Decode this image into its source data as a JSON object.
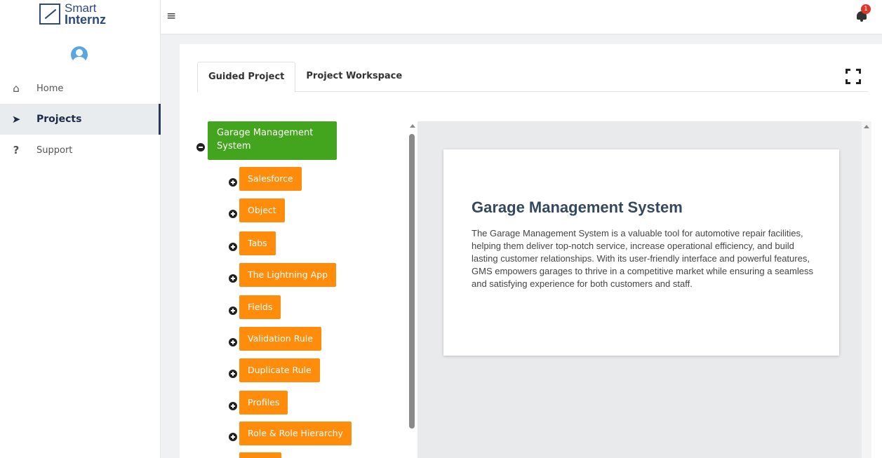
{
  "brand": {
    "line1": "Smart",
    "line2": "Internz"
  },
  "sidebar": {
    "items": [
      {
        "label": "Home",
        "icon": "home-icon"
      },
      {
        "label": "Projects",
        "icon": "paper-plane-icon",
        "active": true
      },
      {
        "label": "Support",
        "icon": "question-icon"
      }
    ]
  },
  "topbar": {
    "menu_icon": "≡",
    "notification_count": "1"
  },
  "tabs": [
    {
      "label": "Guided Project",
      "active": true
    },
    {
      "label": "Project Workspace",
      "active": false
    }
  ],
  "tree": {
    "root": "Garage Management System",
    "children": [
      "Salesforce",
      "Object",
      "Tabs",
      "The Lightning App",
      "Fields",
      "Validation Rule",
      "Duplicate Rule",
      "Profiles",
      "Role & Role Hierarchy",
      ""
    ]
  },
  "content": {
    "title": "Garage Management System",
    "description": "The Garage Management System is a valuable tool for automotive repair facilities, helping them deliver top-notch service, increase operational efficiency, and build lasting customer relationships. With its user-friendly interface and powerful features, GMS empowers garages to thrive in a competitive market while ensuring a seamless and satisfying experience for both customers and staff."
  },
  "colors": {
    "root_node": "#43a41d",
    "child_node": "#ff8c0a",
    "brand": "#2d4a7a",
    "badge": "#e0352b"
  }
}
